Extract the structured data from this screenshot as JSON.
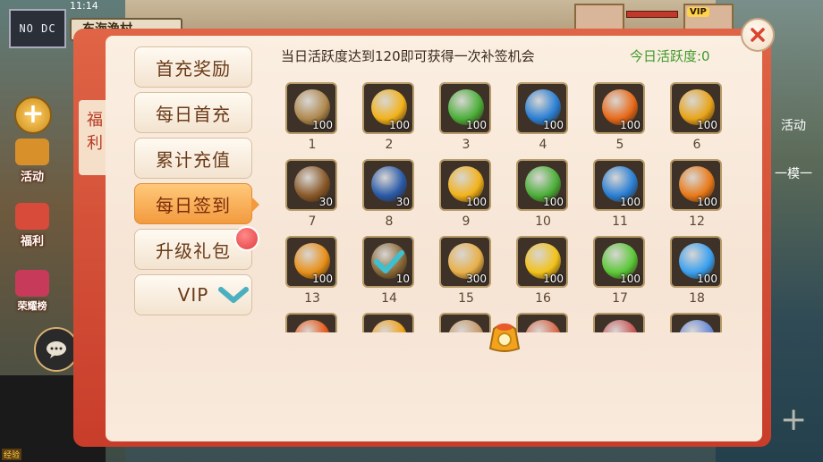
{
  "status": {
    "time": "11:14"
  },
  "location": "东海渔村",
  "overlay": {
    "nodc": "NO DC"
  },
  "left_buttons": [
    {
      "label": "活动",
      "icon": "activity-bag-icon"
    },
    {
      "label": "福利",
      "icon": "gift-box-icon"
    },
    {
      "label": "荣耀榜",
      "icon": "honor-board-icon"
    }
  ],
  "right_labels": [
    "活动",
    "一模一"
  ],
  "panel": {
    "side_title": "福利",
    "header_text": "当日活跃度达到120即可获得一次补签机会",
    "activity_text": "今日活跃度:0",
    "menu": [
      {
        "label": "首充奖励",
        "active": false
      },
      {
        "label": "每日首充",
        "active": false
      },
      {
        "label": "累计充值",
        "active": false
      },
      {
        "label": "每日签到",
        "active": true
      },
      {
        "label": "升级礼包",
        "active": false
      },
      {
        "label": "VIP",
        "active": false
      }
    ],
    "items": [
      {
        "day": "1",
        "qty": "100",
        "icon": "mystery-scroll-icon",
        "color": "#b08a50"
      },
      {
        "day": "2",
        "qty": "100",
        "icon": "gold-orb-icon",
        "color": "#f2b21c"
      },
      {
        "day": "3",
        "qty": "100",
        "icon": "green-orb-icon",
        "color": "#4caf3a"
      },
      {
        "day": "4",
        "qty": "100",
        "icon": "blue-orb-icon",
        "color": "#2a7fd4"
      },
      {
        "day": "5",
        "qty": "100",
        "icon": "fire-orb-icon",
        "color": "#e86a1a"
      },
      {
        "day": "6",
        "qty": "100",
        "icon": "gold-orb-icon",
        "color": "#e8a41a"
      },
      {
        "day": "7",
        "qty": "30",
        "icon": "pouch-icon",
        "color": "#8a5a2a"
      },
      {
        "day": "8",
        "qty": "30",
        "icon": "blue-book-icon",
        "color": "#2a5aa8"
      },
      {
        "day": "9",
        "qty": "100",
        "icon": "gold-orb-icon",
        "color": "#f2b21c"
      },
      {
        "day": "10",
        "qty": "100",
        "icon": "green-orb-icon",
        "color": "#4caf3a"
      },
      {
        "day": "11",
        "qty": "100",
        "icon": "blue-orb-icon",
        "color": "#2a7fd4"
      },
      {
        "day": "12",
        "qty": "100",
        "icon": "fire-orb-icon",
        "color": "#e87a1a"
      },
      {
        "day": "13",
        "qty": "100",
        "icon": "fire-orb-icon",
        "color": "#e8901a"
      },
      {
        "day": "14",
        "qty": "10",
        "icon": "pouch-icon",
        "color": "#8a6a3a",
        "checked": true
      },
      {
        "day": "15",
        "qty": "300",
        "icon": "mystery-token-icon",
        "color": "#e8b04a"
      },
      {
        "day": "16",
        "qty": "100",
        "icon": "gold-orb-icon",
        "color": "#f2c21c"
      },
      {
        "day": "17",
        "qty": "100",
        "icon": "green-orb-icon",
        "color": "#5cc83a"
      },
      {
        "day": "18",
        "qty": "100",
        "icon": "blue-orb-icon",
        "color": "#3aa0f0"
      },
      {
        "day": "",
        "qty": "",
        "icon": "fire-orb-icon",
        "color": "#e85a1a"
      },
      {
        "day": "",
        "qty": "",
        "icon": "gold-orb-icon",
        "color": "#f2a21c"
      },
      {
        "day": "",
        "qty": "",
        "icon": "token-icon",
        "color": "#c89a6a"
      },
      {
        "day": "",
        "qty": "",
        "icon": "lantern-icon",
        "color": "#d86a4a"
      },
      {
        "day": "",
        "qty": "",
        "icon": "mask-icon",
        "color": "#c85a5a"
      },
      {
        "day": "",
        "qty": "",
        "icon": "blade-icon",
        "color": "#6a8ad8"
      }
    ],
    "colors": {
      "accent_red": "#c83d2a",
      "active_green": "#3f9a2a"
    }
  },
  "misc": {
    "vip_pill": "VIP",
    "bottom_tag": "经验"
  }
}
